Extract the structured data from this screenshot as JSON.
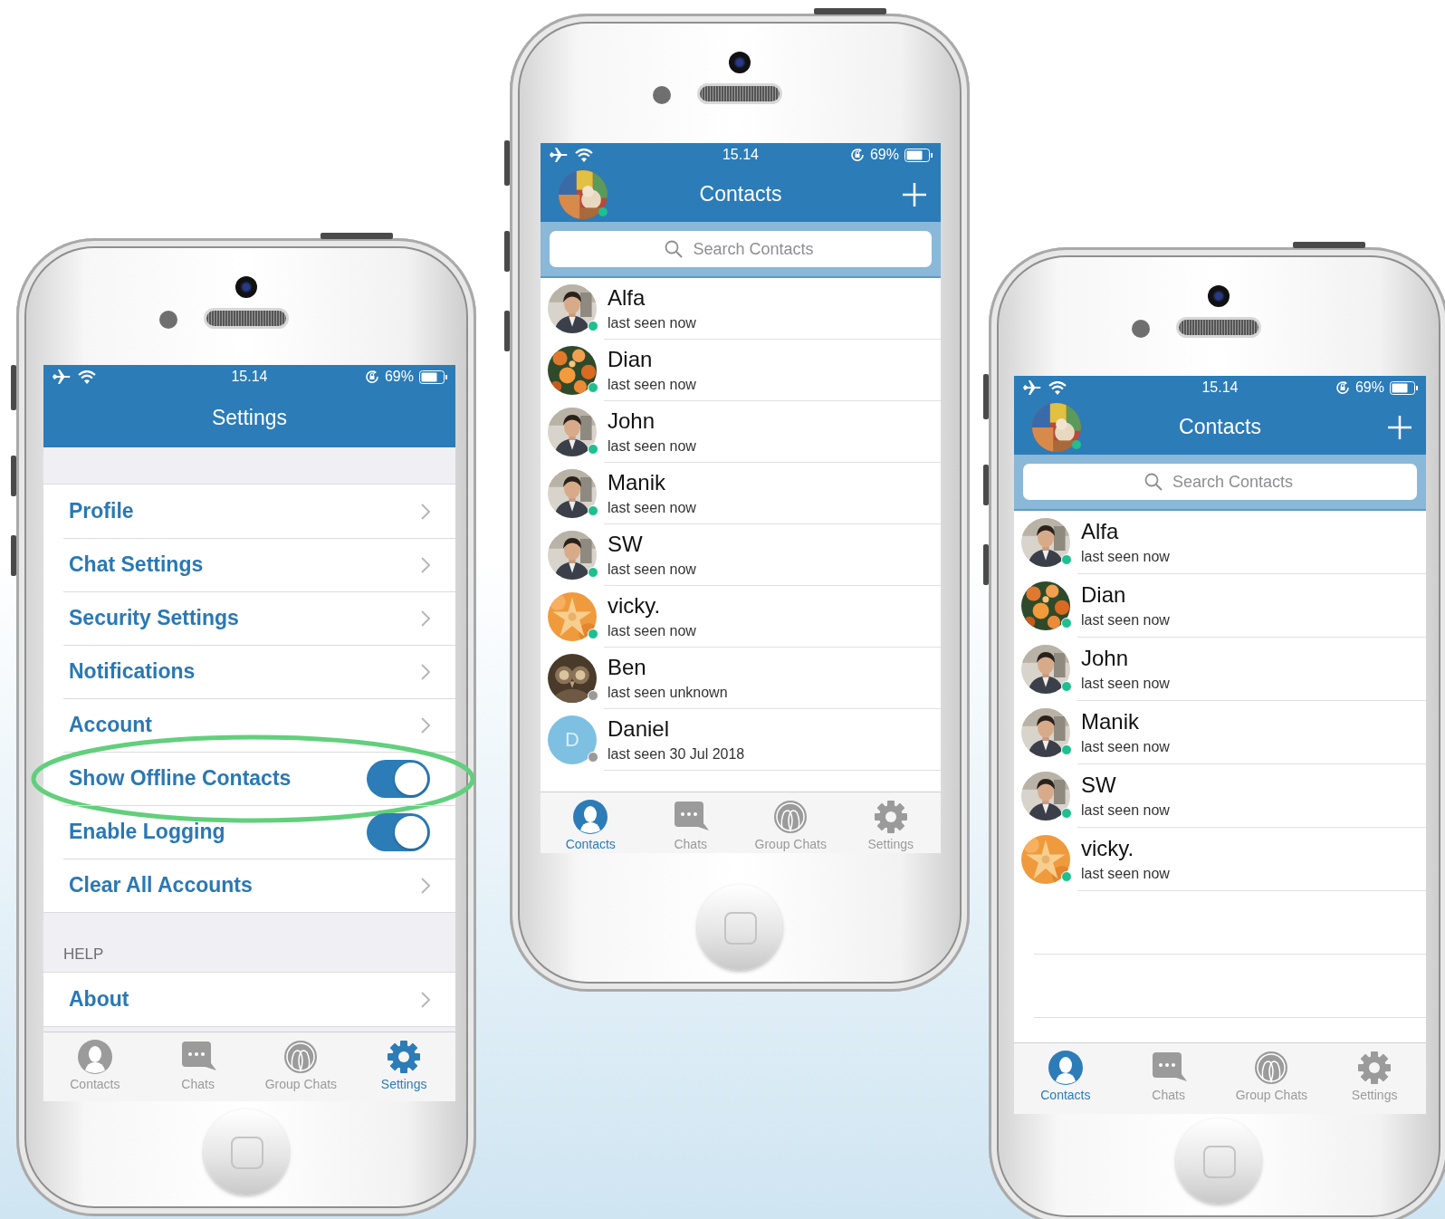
{
  "phones": [
    {
      "kind": "settings",
      "status_bar": {
        "time": "15.14",
        "battery": "69%"
      },
      "title": "Settings",
      "items": [
        {
          "label": "Profile",
          "kind": "link"
        },
        {
          "label": "Chat Settings",
          "kind": "link"
        },
        {
          "label": "Security Settings",
          "kind": "link"
        },
        {
          "label": "Notifications",
          "kind": "link"
        },
        {
          "label": "Account",
          "kind": "link"
        },
        {
          "label": "Show Offline Contacts",
          "kind": "toggle",
          "on": true,
          "highlighted": true
        },
        {
          "label": "Enable Logging",
          "kind": "toggle",
          "on": true,
          "highlighted": false
        },
        {
          "label": "Clear All Accounts",
          "kind": "link"
        }
      ],
      "sections": [
        {
          "header": "HELP",
          "items": [
            {
              "label": "About",
              "kind": "link"
            }
          ]
        }
      ],
      "tabs": [
        {
          "label": "Contacts",
          "selected": false
        },
        {
          "label": "Chats",
          "selected": false
        },
        {
          "label": "Group Chats",
          "selected": false
        },
        {
          "label": "Settings",
          "selected": true
        }
      ]
    },
    {
      "kind": "contacts",
      "status_bar": {
        "time": "15.14",
        "battery": "69%"
      },
      "title": "Contacts",
      "search": {
        "placeholder": "Search Contacts"
      },
      "contacts": [
        {
          "name": "Alfa",
          "status": "last seen now",
          "online": true
        },
        {
          "name": "Dian",
          "status": "last seen now",
          "online": true
        },
        {
          "name": "John",
          "status": "last seen now",
          "online": true
        },
        {
          "name": "Manik",
          "status": "last seen now",
          "online": true
        },
        {
          "name": "SW",
          "status": "last seen now",
          "online": true
        },
        {
          "name": "vicky.",
          "status": "last seen now",
          "online": true
        },
        {
          "name": "Ben",
          "status": "last seen unknown",
          "online": false
        },
        {
          "name": "Daniel",
          "status": "last seen 30 Jul 2018",
          "online": false,
          "avatar": {
            "initial": "D"
          }
        }
      ],
      "tabs": [
        {
          "label": "Contacts",
          "selected": true
        },
        {
          "label": "Chats",
          "selected": false
        },
        {
          "label": "Group Chats",
          "selected": false
        },
        {
          "label": "Settings",
          "selected": false
        }
      ]
    },
    {
      "kind": "contacts",
      "status_bar": {
        "time": "15.14",
        "battery": "69%"
      },
      "title": "Contacts",
      "search": {
        "placeholder": "Search Contacts"
      },
      "contacts": [
        {
          "name": "Alfa",
          "status": "last seen now",
          "online": true
        },
        {
          "name": "Dian",
          "status": "last seen now",
          "online": true
        },
        {
          "name": "John",
          "status": "last seen now",
          "online": true
        },
        {
          "name": "Manik",
          "status": "last seen now",
          "online": true
        },
        {
          "name": "SW",
          "status": "last seen now",
          "online": true
        },
        {
          "name": "vicky.",
          "status": "last seen now",
          "online": true
        }
      ],
      "tabs": [
        {
          "label": "Contacts",
          "selected": true
        },
        {
          "label": "Chats",
          "selected": false
        },
        {
          "label": "Group Chats",
          "selected": false
        },
        {
          "label": "Settings",
          "selected": false
        }
      ]
    }
  ]
}
